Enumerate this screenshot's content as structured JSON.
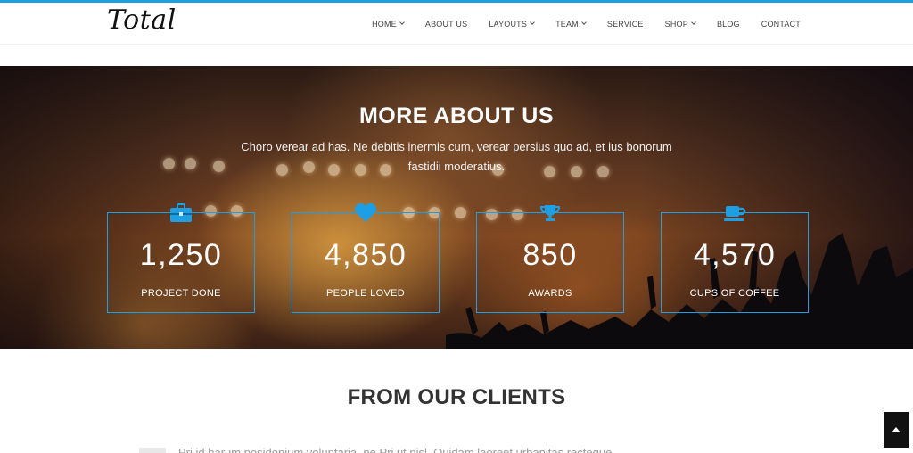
{
  "header": {
    "logo": "Total",
    "nav": [
      {
        "label": "HOME",
        "dropdown": true
      },
      {
        "label": "ABOUT US",
        "dropdown": false
      },
      {
        "label": "LAYOUTS",
        "dropdown": true
      },
      {
        "label": "TEAM",
        "dropdown": true
      },
      {
        "label": "SERVICE",
        "dropdown": false
      },
      {
        "label": "SHOP",
        "dropdown": true
      },
      {
        "label": "BLOG",
        "dropdown": false
      },
      {
        "label": "CONTACT",
        "dropdown": false
      }
    ]
  },
  "about": {
    "title": "MORE ABOUT US",
    "description": "Choro verear ad has. Ne debitis inermis cum, verear persius quo ad, et ius bonorum fastidii moderatius.",
    "stats": [
      {
        "icon": "briefcase-icon",
        "number": "1,250",
        "label": "PROJECT DONE"
      },
      {
        "icon": "heart-icon",
        "number": "4,850",
        "label": "PEOPLE LOVED"
      },
      {
        "icon": "trophy-icon",
        "number": "850",
        "label": "AWARDS"
      },
      {
        "icon": "coffee-cup-icon",
        "number": "4,570",
        "label": "CUPS OF COFFEE"
      }
    ]
  },
  "clients": {
    "title": "FROM OUR CLIENTS",
    "snippet": "Pri id harum posidonium voluptaria, ne Pri ut nisl, Quidam laoreet urbanitas recteque"
  },
  "colors": {
    "accent": "#1c9fe4",
    "text_dark": "#333333"
  },
  "scroll_top": {
    "icon": "chevron-up-icon"
  }
}
